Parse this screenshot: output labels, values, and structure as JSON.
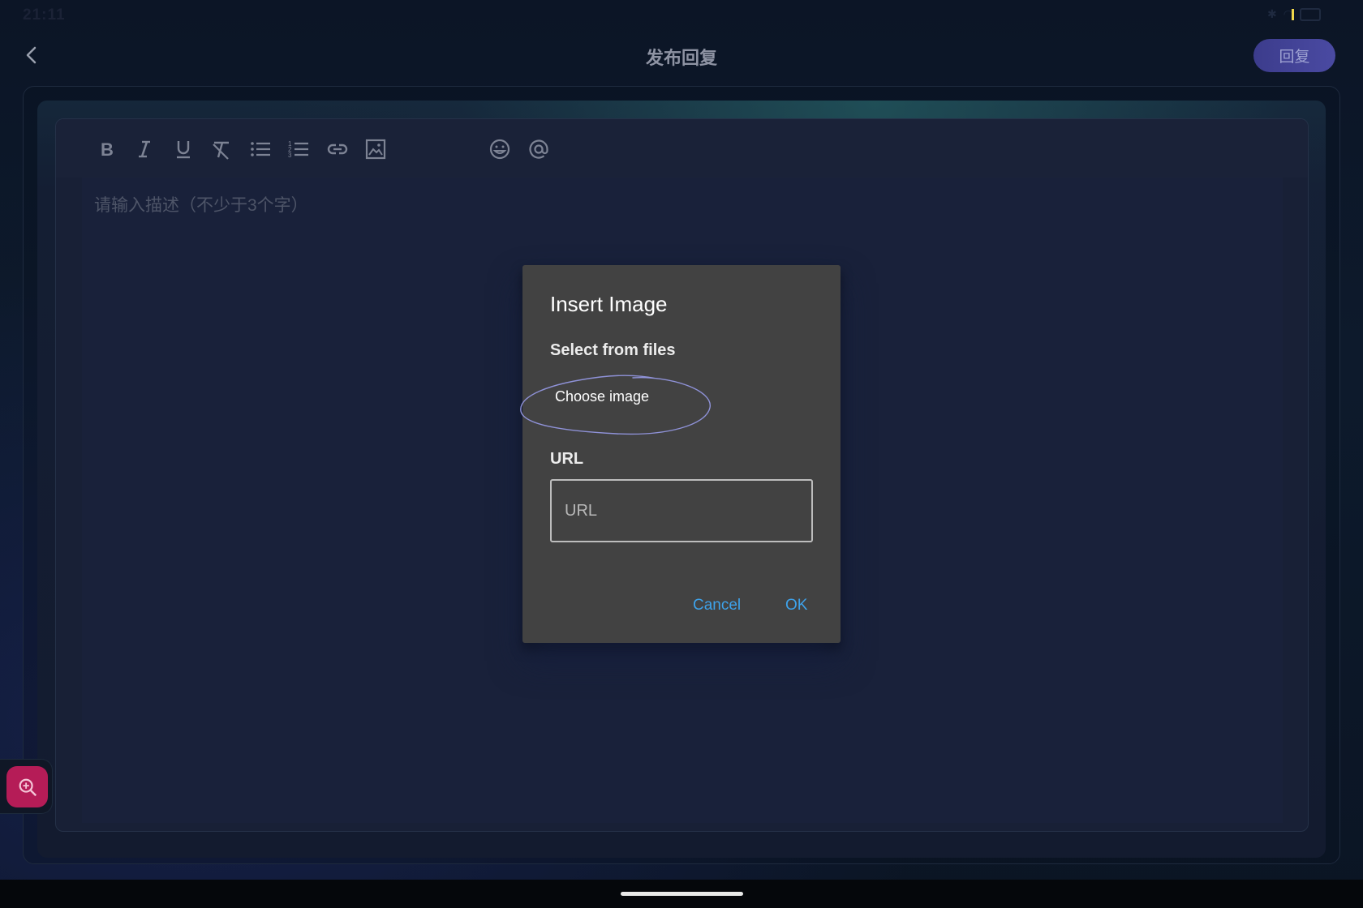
{
  "status": {
    "time": "21:11"
  },
  "header": {
    "title": "发布回复",
    "reply_label": "回复"
  },
  "editor": {
    "toolbar": [
      {
        "name": "bold-icon"
      },
      {
        "name": "italic-icon"
      },
      {
        "name": "underline-icon"
      },
      {
        "name": "clear-format-icon"
      },
      {
        "name": "bullet-list-icon"
      },
      {
        "name": "numbered-list-icon"
      },
      {
        "name": "link-icon"
      },
      {
        "name": "image-icon"
      },
      {
        "name": "emoji-icon"
      },
      {
        "name": "mention-icon"
      }
    ],
    "placeholder": "请输入描述（不少于3个字）"
  },
  "dialog": {
    "title": "Insert Image",
    "select_label": "Select from files",
    "choose_label": "Choose image",
    "url_label": "URL",
    "url_placeholder": "URL",
    "cancel_label": "Cancel",
    "ok_label": "OK"
  },
  "colors": {
    "accent": "#3ea2ea",
    "fab": "#b51c57",
    "reply_button": "#44449a",
    "annotation": "#8f92d8"
  }
}
